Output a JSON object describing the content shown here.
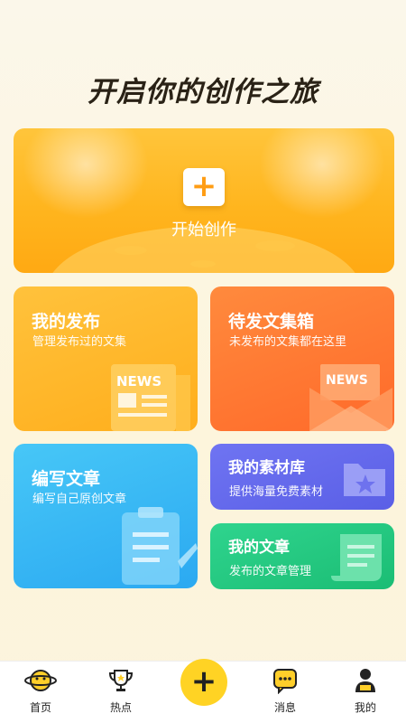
{
  "headline": "开启你的创作之旅",
  "hero": {
    "label": "开始创作",
    "icon": "plus-icon"
  },
  "cards": {
    "publish": {
      "title": "我的发布",
      "subtitle": "管理发布过的文集",
      "icon": "news-paper-icon",
      "color": "#ffb51e"
    },
    "drafts": {
      "title": "待发文集箱",
      "subtitle": "未发布的文集都在这里",
      "icon": "news-envelope-icon",
      "color": "#ff7a33"
    },
    "write": {
      "title": "编写文章",
      "subtitle": "编写自己原创文章",
      "icon": "clipboard-icon",
      "color": "#2ba9f1"
    },
    "materials": {
      "title": "我的素材库",
      "subtitle": "提供海量免费素材",
      "icon": "folder-star-icon",
      "color": "#5a5fe6"
    },
    "articles": {
      "title": "我的文章",
      "subtitle": "发布的文章管理",
      "icon": "scroll-icon",
      "color": "#1bbd74"
    }
  },
  "nav": {
    "items": [
      {
        "label": "首页",
        "icon": "planet-icon"
      },
      {
        "label": "热点",
        "icon": "trophy-icon"
      },
      {
        "label": "+",
        "icon": "plus-icon"
      },
      {
        "label": "消息",
        "icon": "chat-icon"
      },
      {
        "label": "我的",
        "icon": "person-icon"
      }
    ],
    "accent": "#ffd324"
  }
}
